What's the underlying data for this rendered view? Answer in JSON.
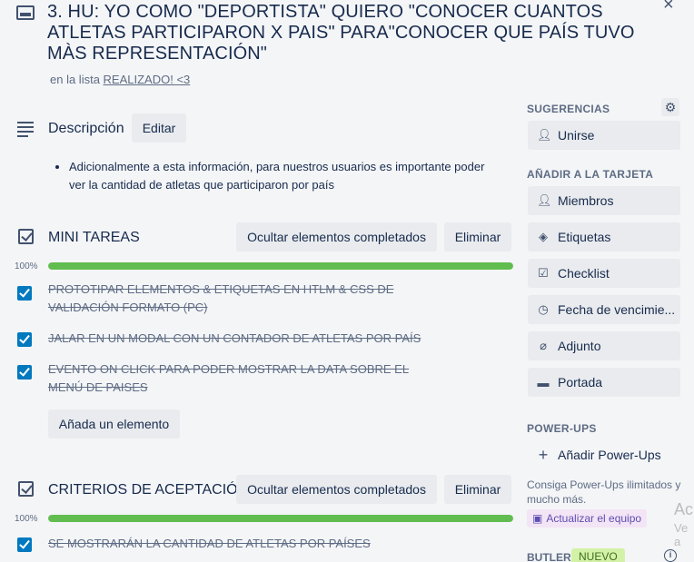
{
  "header": {
    "title": "3. HU: YO COMO \"DEPORTISTA\" QUIERO \"CONOCER CUANTOS ATLETAS PARTICIPARON X PAIS\" PARA\"CONOCER QUE PAÍS TUVO MÀS REPRESENTACIÓN\"",
    "in_list_prefix": "en la lista",
    "list_name": "REALIZADO! <3",
    "close": "×"
  },
  "description": {
    "title": "Descripción",
    "edit_label": "Editar",
    "text": "Adicionalmente a esta información, para nuestros usuarios es importante poder ver la cantidad de atletas que participaron por país"
  },
  "checklists": [
    {
      "title": "MINI TAREAS",
      "hide_label": "Ocultar elementos completados",
      "delete_label": "Eliminar",
      "progress_label": "100%",
      "progress": 1.0,
      "items": [
        "PROTOTIPAR ELEMENTOS & ETIQUETAS EN HTLM & CSS DE VALIDACIÓN FORMATO (PC)",
        "JALAR EN UN MODAL CON UN CONTADOR DE ATLETAS POR PAÍS",
        "EVENTO ON CLICK PARA PODER MOSTRAR LA DATA SOBRE EL MENÚ DE PAISES"
      ],
      "add_label": "Añada un elemento"
    },
    {
      "title": "CRITERIOS DE ACEPTACIÓN",
      "hide_label": "Ocultar elementos completados",
      "delete_label": "Eliminar",
      "progress_label": "100%",
      "progress": 1.0,
      "items": [
        "SE MOSTRARÁN LA CANTIDAD DE ATLETAS POR PAÍSES"
      ]
    }
  ],
  "sidebar": {
    "suggestions_title": "SUGERENCIAS",
    "join_label": "Unirse",
    "add_to_card_title": "AÑADIR A LA TARJETA",
    "members_label": "Miembros",
    "labels_label": "Etiquetas",
    "checklist_label": "Checklist",
    "due_date_label": "Fecha de vencimie...",
    "attachment_label": "Adjunto",
    "cover_label": "Portada",
    "powerups_title": "POWER-UPS",
    "add_powerups_label": "Añadir Power-Ups",
    "powerups_text": "Consiga Power-Ups ilimitados y mucho más.",
    "upgrade_label": "Actualizar el equipo",
    "butler_title": "BUTLER",
    "new_badge": "NUEVO"
  },
  "watermark": {
    "line1": "Ac",
    "line2": "Ve a"
  },
  "colors": {
    "progress": "#61bd4f",
    "checkbox": "#0079bf",
    "background": "#f4f5f7"
  }
}
